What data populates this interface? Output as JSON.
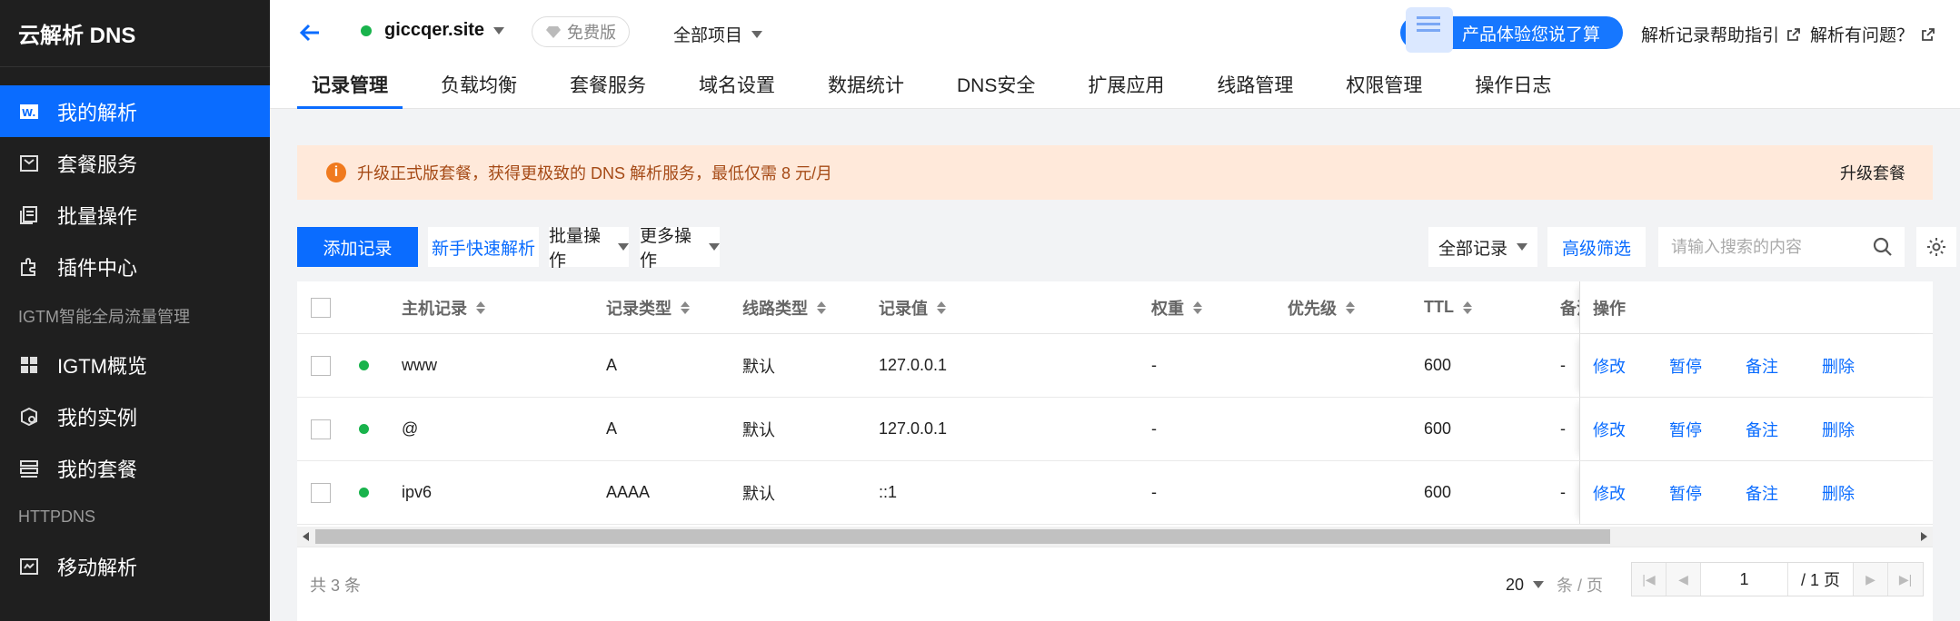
{
  "sidebar": {
    "brand": "云解析 DNS",
    "items_top": [
      {
        "label": "我的解析",
        "icon": "dns-record-icon",
        "active": true
      },
      {
        "label": "套餐服务",
        "icon": "package-icon"
      },
      {
        "label": "批量操作",
        "icon": "batch-icon"
      },
      {
        "label": "插件中心",
        "icon": "plugin-icon"
      }
    ],
    "group_igtm": "IGTM智能全局流量管理",
    "items_igtm": [
      {
        "label": "IGTM概览",
        "icon": "grid-icon"
      },
      {
        "label": "我的实例",
        "icon": "instance-icon"
      },
      {
        "label": "我的套餐",
        "icon": "list-icon"
      }
    ],
    "group_httpdns": "HTTPDNS",
    "items_httpdns": [
      {
        "label": "移动解析",
        "icon": "mobile-dns-icon"
      }
    ]
  },
  "header": {
    "domain": "giccqer.site",
    "plan_badge": "免费版",
    "project": "全部项目",
    "feedback": "产品体验您说了算",
    "help_guide": "解析记录帮助指引",
    "help_problem": "解析有问题？",
    "tabs": [
      "记录管理",
      "负载均衡",
      "套餐服务",
      "域名设置",
      "数据统计",
      "DNS安全",
      "扩展应用",
      "线路管理",
      "权限管理",
      "操作日志"
    ]
  },
  "notice": {
    "text": "升级正式版套餐，获得更极致的 DNS 解析服务，最低仅需 8 元/月",
    "action": "升级套餐"
  },
  "toolbar": {
    "add_record": "添加记录",
    "quick_setup": "新手快速解析",
    "batch_ops": "批量操作",
    "more_ops": "更多操作",
    "filter_all": "全部记录",
    "advanced_filter": "高级筛选",
    "search_placeholder": "请输入搜索的内容"
  },
  "table": {
    "headers": {
      "host": "主机记录",
      "type": "记录类型",
      "line": "线路类型",
      "value": "记录值",
      "weight": "权重",
      "priority": "优先级",
      "ttl": "TTL",
      "remark": "备注",
      "ops": "操作"
    },
    "rows": [
      {
        "host": "www",
        "type": "A",
        "line": "默认",
        "value": "127.0.0.1",
        "weight": "-",
        "priority": "",
        "ttl": "600",
        "remark": "-"
      },
      {
        "host": "@",
        "type": "A",
        "line": "默认",
        "value": "127.0.0.1",
        "weight": "-",
        "priority": "",
        "ttl": "600",
        "remark": "-"
      },
      {
        "host": "ipv6",
        "type": "AAAA",
        "line": "默认",
        "value": "::1",
        "weight": "-",
        "priority": "",
        "ttl": "600",
        "remark": "-"
      }
    ],
    "ops": {
      "edit": "修改",
      "pause": "暂停",
      "note": "备注",
      "delete": "删除"
    }
  },
  "footer": {
    "total": "共 3 条",
    "page_size": "20",
    "page_size_unit": "条 / 页",
    "current_page": "1",
    "total_pages": "/ 1 页"
  },
  "colors": {
    "accent": "#0a6cff",
    "sidebar_bg": "#1f1f1f",
    "status_ok": "#19b34c",
    "notice_bg": "#ffe9da"
  }
}
